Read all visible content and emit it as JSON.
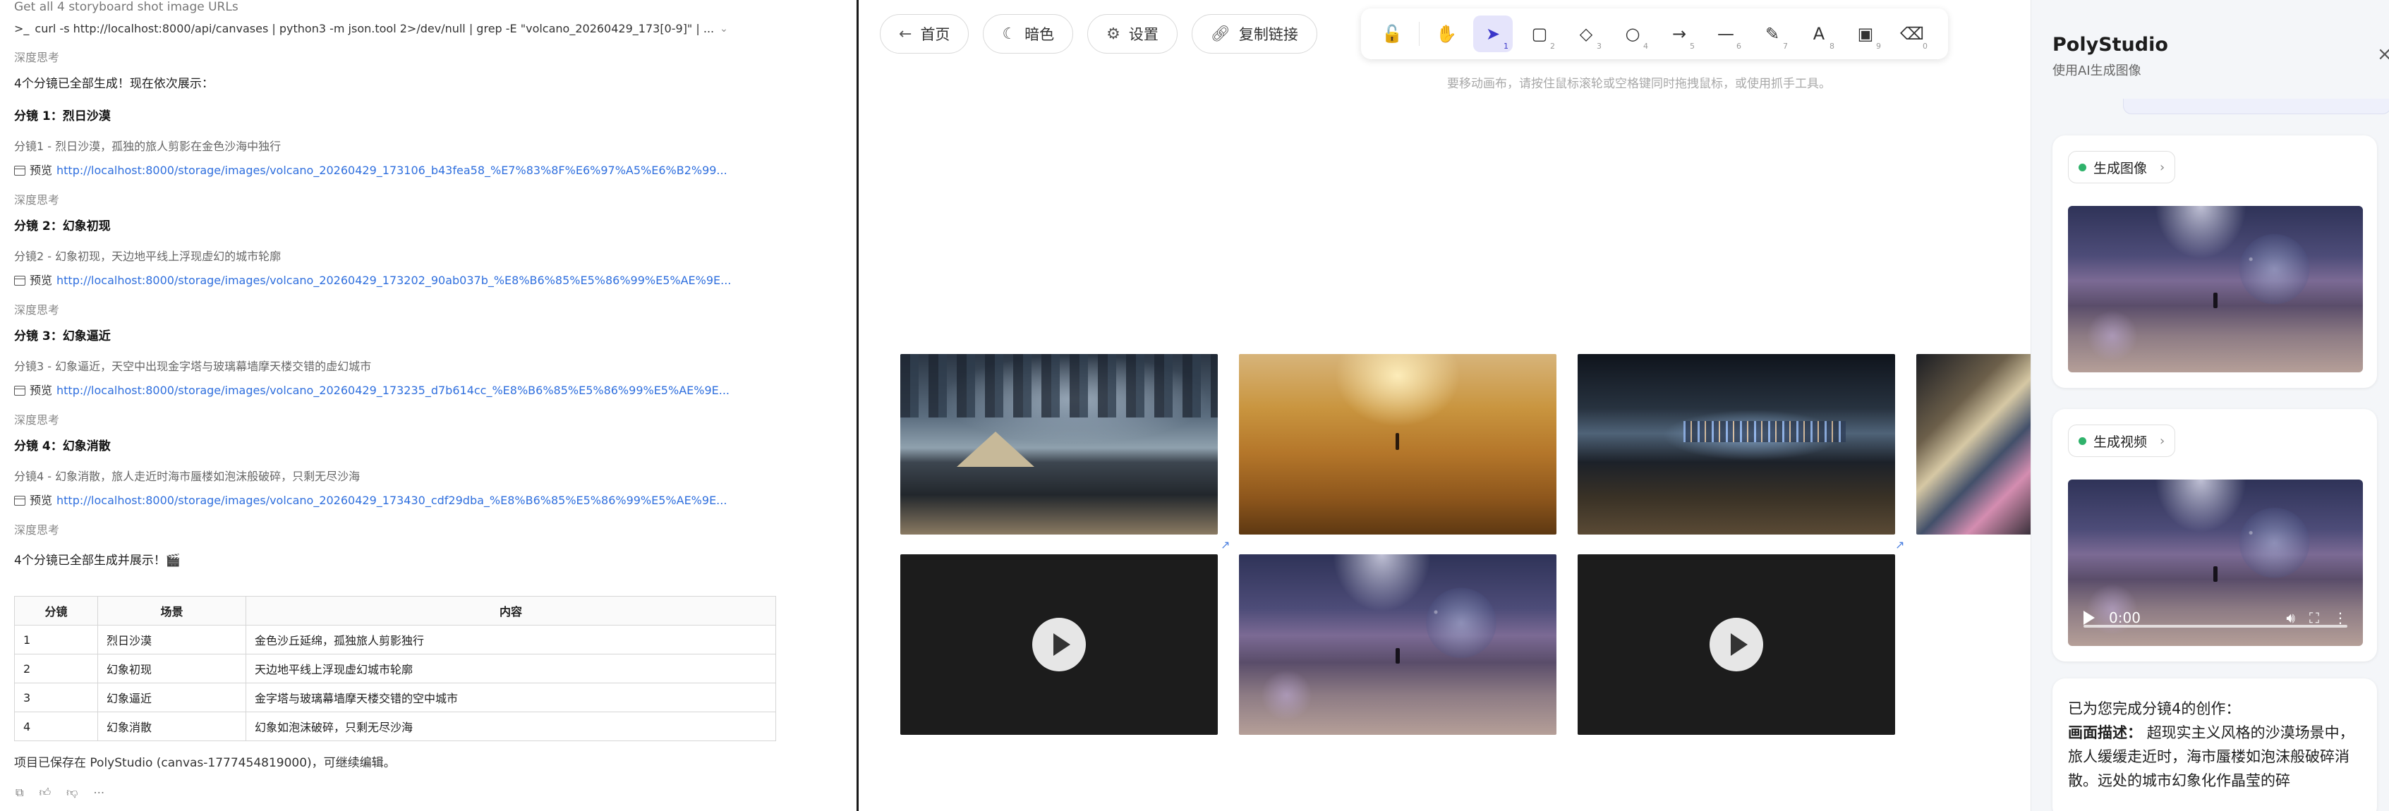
{
  "chat": {
    "cmd_title": "Get all 4 storyboard shot image URLs",
    "cmd_line": "curl -s http://localhost:8000/api/canvases | python3 -m json.tool 2>/dev/null | grep -E \"volcano_20260429_173[0-9]\" | ...",
    "think_label": "深度思考",
    "intro": "4个分镜已全部生成！现在依次展示：",
    "preview_label": "预览",
    "shots": [
      {
        "heading": "分镜 1：烈日沙漠",
        "desc": "分镜1 - 烈日沙漠，孤独的旅人剪影在金色沙海中独行",
        "url": "http://localhost:8000/storage/images/volcano_20260429_173106_b43fea58_%E7%83%8F%E6%97%A5%E6%B2%99..."
      },
      {
        "heading": "分镜 2：幻象初现",
        "desc": "分镜2 - 幻象初现，天边地平线上浮现虚幻的城市轮廓",
        "url": "http://localhost:8000/storage/images/volcano_20260429_173202_90ab037b_%E8%B6%85%E5%86%99%E5%AE%9E..."
      },
      {
        "heading": "分镜 3：幻象逼近",
        "desc": "分镜3 - 幻象逼近，天空中出现金字塔与玻璃幕墙摩天楼交错的虚幻城市",
        "url": "http://localhost:8000/storage/images/volcano_20260429_173235_d7b614cc_%E8%B6%85%E5%86%99%E5%AE%9E..."
      },
      {
        "heading": "分镜 4：幻象消散",
        "desc": "分镜4 - 幻象消散，旅人走近时海市蜃楼如泡沫般破碎，只剩无尽沙海",
        "url": "http://localhost:8000/storage/images/volcano_20260429_173430_cdf29dba_%E8%B6%85%E5%86%99%E5%AE%9E..."
      }
    ],
    "done_msg": "4个分镜已全部生成并展示！🎬",
    "table": {
      "headers": [
        "分镜",
        "场景",
        "内容"
      ],
      "rows": [
        [
          "1",
          "烈日沙漠",
          "金色沙丘延绵，孤独旅人剪影独行"
        ],
        [
          "2",
          "幻象初现",
          "天边地平线上浮现虚幻城市轮廓"
        ],
        [
          "3",
          "幻象逼近",
          "金字塔与玻璃幕墙摩天楼交错的空中城市"
        ],
        [
          "4",
          "幻象消散",
          "幻象如泡沫破碎，只剩无尽沙海"
        ]
      ]
    },
    "saved_msg": "项目已保存在 PolyStudio (canvas-1777454819000)，可继续编辑。"
  },
  "canvas": {
    "buttons": {
      "home": "首页",
      "dark": "暗色",
      "settings": "设置",
      "copy_link": "复制链接"
    },
    "tools": [
      {
        "icon": "lock-icon",
        "glyph": "🔓",
        "num": ""
      },
      {
        "icon": "hand-icon",
        "glyph": "✋",
        "num": ""
      },
      {
        "icon": "cursor-icon",
        "glyph": "➤",
        "num": "1"
      },
      {
        "icon": "rectangle-icon",
        "glyph": "▢",
        "num": "2"
      },
      {
        "icon": "diamond-icon",
        "glyph": "◇",
        "num": "3"
      },
      {
        "icon": "circle-icon",
        "glyph": "○",
        "num": "4"
      },
      {
        "icon": "arrow-icon",
        "glyph": "→",
        "num": "5"
      },
      {
        "icon": "line-icon",
        "glyph": "—",
        "num": "6"
      },
      {
        "icon": "pencil-icon",
        "glyph": "✎",
        "num": "7"
      },
      {
        "icon": "text-icon",
        "glyph": "A",
        "num": "8"
      },
      {
        "icon": "image-icon",
        "glyph": "▣",
        "num": "9"
      },
      {
        "icon": "eraser-icon",
        "glyph": "⌫",
        "num": "0"
      }
    ],
    "hint": "要移动画布，请按住鼠标滚轮或空格键同时拖拽鼠标，或使用抓手工具。"
  },
  "panel": {
    "title": "PolyStudio",
    "subtitle": "使用AI生成图像",
    "image_chip": "生成图像",
    "video_chip": "生成视频",
    "video_time": "0:00",
    "reply_line1": "已为您完成分镜4的创作：",
    "reply_label": "画面描述：",
    "reply_text": "超现实主义风格的沙漠场景中，旅人缓缓走近时，海市蜃楼如泡沫般破碎消散。远处的城市幻象化作晶莹的碎"
  }
}
